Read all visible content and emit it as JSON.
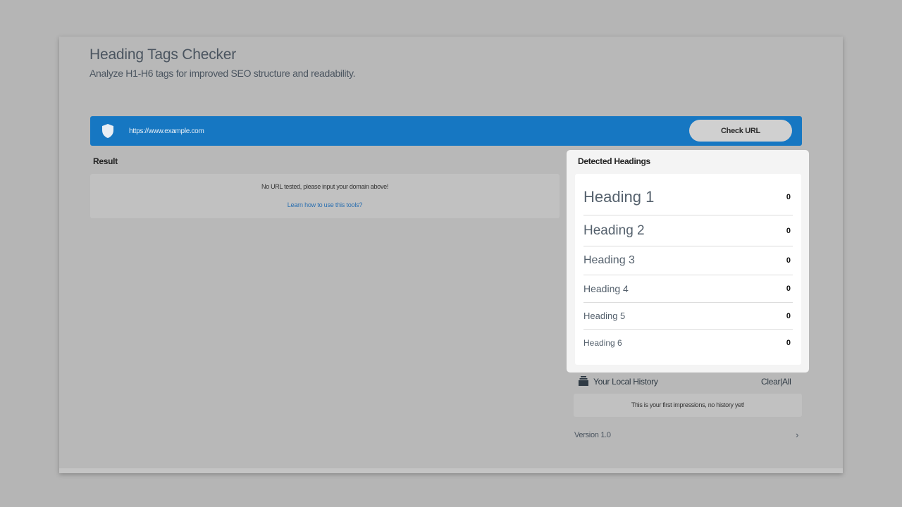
{
  "header": {
    "title": "Heading Tags Checker",
    "subtitle": "Analyze H1-H6 tags for improved SEO structure and readability."
  },
  "url_bar": {
    "placeholder": "https://www.example.com",
    "button_label": "Check URL",
    "icon": "shield-icon",
    "bar_color": "#1677c2"
  },
  "result": {
    "label": "Result",
    "message": "No URL tested, please input your domain above!",
    "link": "Learn how to use this tools?"
  },
  "detected": {
    "title": "Detected Headings",
    "rows": [
      {
        "label": "Heading 1",
        "count": "0"
      },
      {
        "label": "Heading 2",
        "count": "0"
      },
      {
        "label": "Heading 3",
        "count": "0"
      },
      {
        "label": "Heading 4",
        "count": "0"
      },
      {
        "label": "Heading 5",
        "count": "0"
      },
      {
        "label": "Heading 6",
        "count": "0"
      }
    ]
  },
  "history": {
    "icon": "archive-icon",
    "label": "Your Local History",
    "clear_label": "Clear|All",
    "message": "This is your first impressions, no history yet!"
  },
  "footer": {
    "version": "Version 1.0",
    "chevron": "›"
  }
}
